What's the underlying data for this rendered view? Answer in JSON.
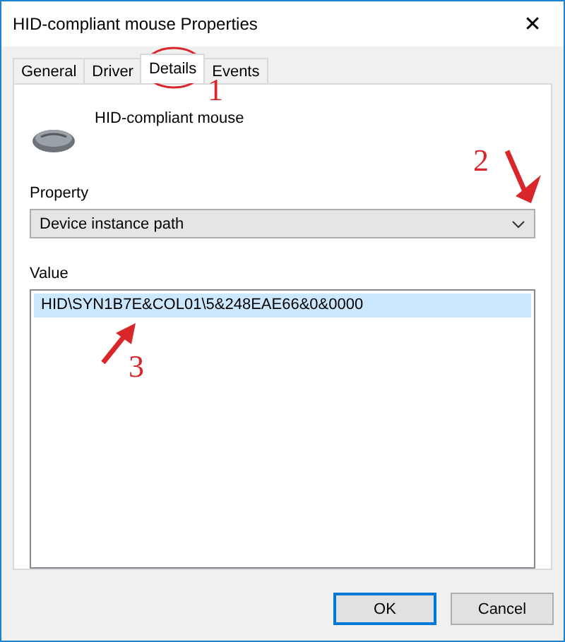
{
  "window": {
    "title": "HID-compliant mouse Properties",
    "close": "✕"
  },
  "tabs": [
    {
      "label": "General",
      "selected": false
    },
    {
      "label": "Driver",
      "selected": false
    },
    {
      "label": "Details",
      "selected": true
    },
    {
      "label": "Events",
      "selected": false
    }
  ],
  "device": {
    "name": "HID-compliant mouse"
  },
  "property": {
    "label": "Property",
    "value": "Device instance path"
  },
  "value_list": {
    "label": "Value",
    "rows": [
      {
        "text": "HID\\SYN1B7E&COL01\\5&248EAE66&0&0000",
        "selected": true
      }
    ]
  },
  "annotations": [
    {
      "kind": "circle",
      "number": "1"
    },
    {
      "kind": "arrow-down",
      "number": "2"
    },
    {
      "kind": "arrow-up",
      "number": "3"
    }
  ],
  "buttons": [
    {
      "label": "OK",
      "default": true
    },
    {
      "label": "Cancel",
      "default": false
    }
  ]
}
